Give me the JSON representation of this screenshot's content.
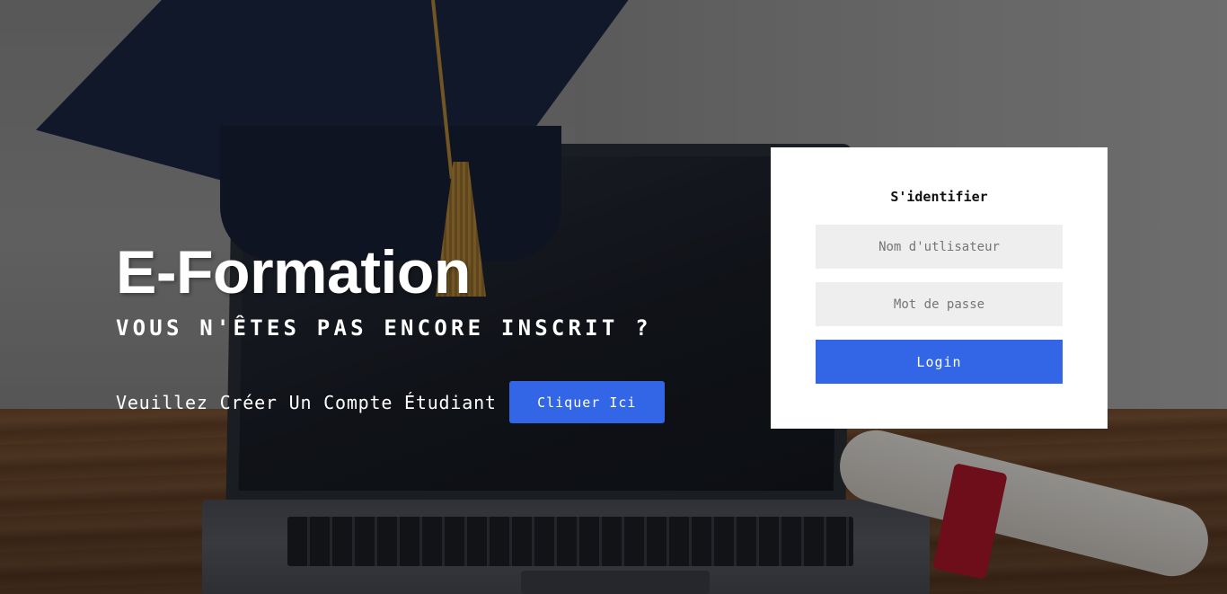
{
  "hero": {
    "title": "E-Formation",
    "subtitle": "VOUS N'ÊTES PAS ENCORE INSCRIT ?",
    "cta_text": "Veuillez Créer Un Compte Étudiant",
    "cta_button_label": "Cliquer Ici"
  },
  "login": {
    "title": "S'identifier",
    "username_placeholder": "Nom d'utlisateur",
    "password_placeholder": "Mot de passe",
    "submit_label": "Login"
  },
  "colors": {
    "accent": "#3366e6",
    "card_background": "#ffffff",
    "input_background": "#eeeeee"
  },
  "background_image": "graduation-cap-on-laptop-photo"
}
